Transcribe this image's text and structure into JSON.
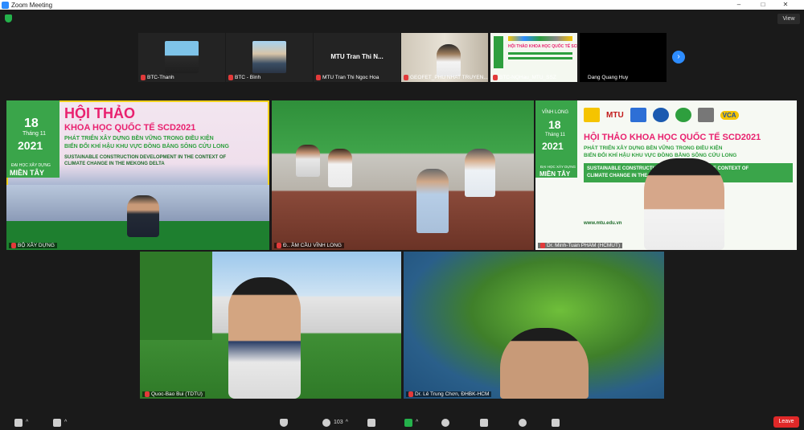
{
  "window": {
    "title": "Zoom Meeting",
    "minimize": "–",
    "maximize": "□",
    "close": "✕"
  },
  "header": {
    "view_label": "View"
  },
  "strip": [
    {
      "name": "BTC-Thanh",
      "type": "video"
    },
    {
      "name": "BTC - Bình",
      "type": "video"
    },
    {
      "name": "MTU Tran Thi Ngoc Hoa",
      "display": "MTU Tran Thi N...",
      "type": "name"
    },
    {
      "name": "GEOFET_PHU NHAT TRUYEN...",
      "type": "video"
    },
    {
      "name": "BTC-NQHau_MTU_SSZ",
      "type": "video"
    },
    {
      "name": "Dang Quang Huy",
      "type": "name"
    }
  ],
  "gallery": [
    {
      "name": "BỘ XÂY DỰNG",
      "active": true
    },
    {
      "name": "ĐH XÂY DỰNG... CẦU VĨNH LONG",
      "display": "Đ.. ẦM CẦU VĨNH LONG"
    },
    {
      "name": "Dr. Minh-Tuan PHAM (HCMUT)"
    },
    {
      "name": "Quoc-Bao Bui (TDTU)"
    },
    {
      "name": "Dr. Lê Trung Chơn, ĐHBK-HCM"
    }
  ],
  "banner": {
    "date_day": "18",
    "date_month": "Tháng 11",
    "date_year": "2021",
    "title_line1": "HỘI THẢO",
    "title_line2": "KHOA HỌC QUỐC TẾ SCD2021",
    "title_full": "HỘI THẢO KHOA HỌC QUỐC TẾ SCD2021",
    "sub_line1": "PHÁT TRIỂN XÂY DỰNG BỀN VỮNG TRONG ĐIỀU KIỆN",
    "sub_line2": "BIẾN ĐỔI KHÍ HẬU KHU VỰC ĐỒNG BẰNG SÔNG CỬU LONG",
    "en_line1": "SUSTAINABLE CONSTRUCTION DEVELOPMENT IN THE CONTEXT OF",
    "en_line2": "CLIMATE CHANGE IN THE MEKONG DELTA",
    "school_line1": "ĐẠI HỌC XÂY DỰNG",
    "school_line2": "MIỀN TÂY",
    "city": "VĨNH LONG",
    "website": "www.mtu.edu.vn",
    "logo_mtu": "MTU",
    "logo_vca": "VCA"
  },
  "toolbar": {
    "participants_count": "103",
    "leave_label": "Leave"
  },
  "colors": {
    "accent": "#2d8cff",
    "active_speaker": "#f2d21e",
    "leave": "#e02828",
    "banner_pink": "#e9216f",
    "banner_green": "#2e9f3e"
  }
}
